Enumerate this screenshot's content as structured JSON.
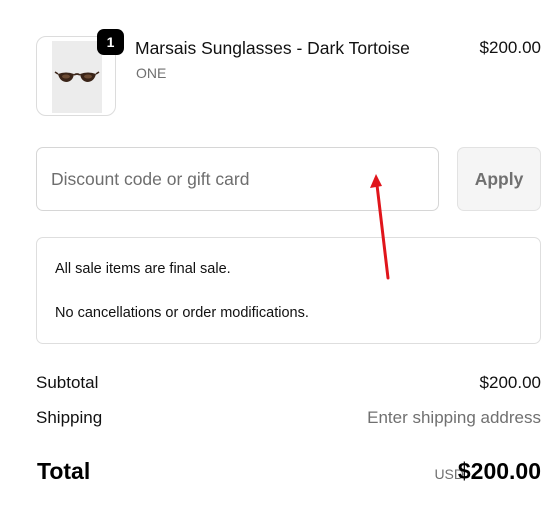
{
  "product": {
    "quantity": "1",
    "name": "Marsais Sunglasses - Dark Tortoise",
    "variant": "ONE",
    "price": "$200.00",
    "image_icon": "sunglasses-icon"
  },
  "discount": {
    "placeholder": "Discount code or gift card",
    "value": "",
    "apply_label": "Apply"
  },
  "notice": {
    "line1": "All sale items are final sale.",
    "line2": "No cancellations or order modifications."
  },
  "summary": {
    "subtotal_label": "Subtotal",
    "subtotal_value": "$200.00",
    "shipping_label": "Shipping",
    "shipping_value": "Enter shipping address"
  },
  "total": {
    "label": "Total",
    "currency": "USD",
    "amount": "$200.00"
  },
  "colors": {
    "badge": "#000000",
    "muted_text": "#707070",
    "annotation_arrow": "#e0151b"
  }
}
